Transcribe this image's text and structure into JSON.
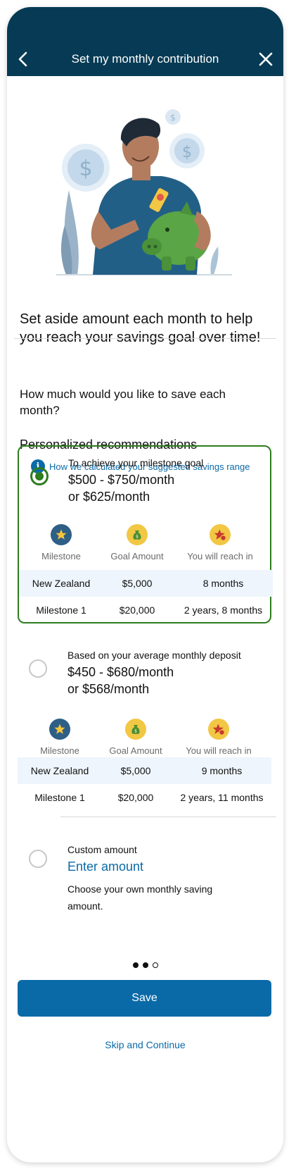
{
  "header": {
    "title": "Set my monthly contribution"
  },
  "intro": "Set aside amount each month to help you reach your savings goal over time!",
  "question": "How much would you like to save each month?",
  "recommendations": {
    "title": "Personalized recommendations",
    "info_link": "How we calculated your suggested savings range"
  },
  "columns": {
    "milestone": "Milestone",
    "goal": "Goal Amount",
    "reach": "You will reach in"
  },
  "options": [
    {
      "label": "To achieve your milestone goal",
      "amount_line1": "$500 - $750/month",
      "amount_line2": "or $625/month",
      "selected": true,
      "rows": [
        {
          "milestone": "New Zealand",
          "goal": "$5,000",
          "reach": "8 months"
        },
        {
          "milestone": "Milestone 1",
          "goal": "$20,000",
          "reach": "2 years, 8 months"
        }
      ]
    },
    {
      "label": "Based on your average monthly deposit",
      "amount_line1": "$450 - $680/month",
      "amount_line2": "or $568/month",
      "selected": false,
      "rows": [
        {
          "milestone": "New Zealand",
          "goal": "$5,000",
          "reach": "9 months"
        },
        {
          "milestone": "Milestone 1",
          "goal": "$20,000",
          "reach": "2 years, 11 months"
        }
      ]
    }
  ],
  "custom": {
    "label": "Custom amount",
    "link": "Enter amount",
    "description": "Choose your own monthly saving amount."
  },
  "pagination": {
    "current": 2,
    "total": 3
  },
  "buttons": {
    "save": "Save",
    "skip": "Skip and Continue"
  },
  "colors": {
    "header": "#073b55",
    "primary": "#0a6aa8",
    "selected_border": "#2e7d1e",
    "row_shade": "#eef5fc"
  },
  "icons": {
    "back": "chevron-left-icon",
    "close": "close-icon",
    "info": "info-icon",
    "milestone": "star-icon",
    "goal": "money-bag-icon",
    "reach": "star-clock-icon"
  }
}
